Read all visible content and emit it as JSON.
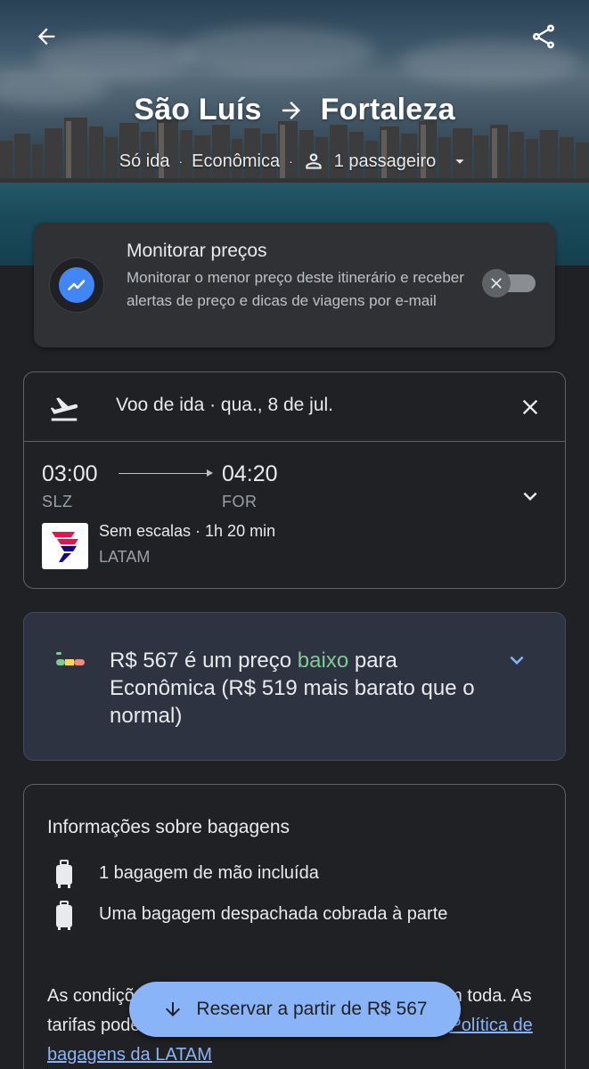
{
  "header": {
    "origin": "São Luís",
    "destination": "Fortaleza",
    "trip_type": "Só ida",
    "cabin_class": "Econômica",
    "passengers": "1 passageiro"
  },
  "monitor": {
    "title": "Monitorar preços",
    "description": "Monitorar o menor preço deste itinerário e receber alertas de preço e dicas de viagens por e-mail",
    "enabled": false
  },
  "flight": {
    "header_label": "Voo de ida · qua., 8 de jul.",
    "depart_time": "03:00",
    "arrive_time": "04:20",
    "depart_code": "SLZ",
    "arrive_code": "FOR",
    "stops_duration": "Sem escalas · 1h 20 min",
    "airline": "LATAM"
  },
  "price_insight": {
    "text_before": "R$ 567 é um preço ",
    "highlight": "baixo",
    "text_after": " para Econômica (R$ 519 mais barato que o normal)"
  },
  "baggage": {
    "title": "Informações sobre bagagens",
    "carry_on": "1 bagagem de mão incluída",
    "checked": "Uma bagagem despachada cobrada à parte",
    "policy_text": "As condições de bagagem podem não ser iguais em toda. As tarifas podem mudar e ser cobradas no aeroporto. ",
    "policy_link": "Política de bagagens da LATAM"
  },
  "reserve_button": {
    "label": "Reservar a partir de R$ 567"
  },
  "colors": {
    "background": "#202124",
    "card": "#303134",
    "accent": "#8ab4f8",
    "price_low": "#81c995",
    "monitor_icon": "#4285f4"
  }
}
